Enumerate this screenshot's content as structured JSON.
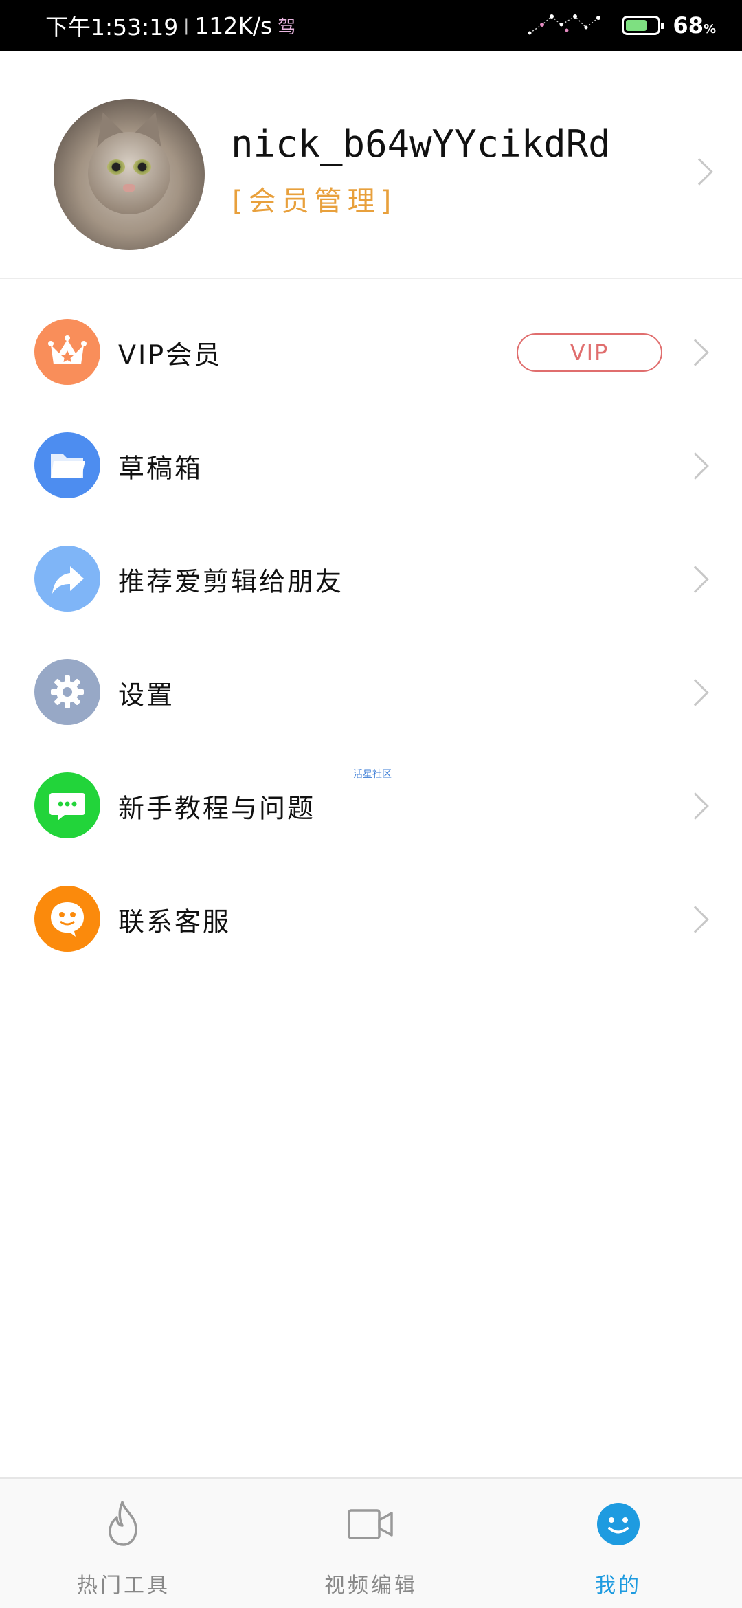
{
  "status_bar": {
    "time": "下午1:53:19",
    "speed": "112K/s",
    "carrier_glyph": "驾",
    "battery_percent": "68",
    "battery_unit": "%",
    "battery_level": 0.68
  },
  "profile": {
    "username": "nick_b64wYYcikdRd",
    "member_link": "[会员管理]"
  },
  "menu": {
    "items": [
      {
        "label": "VIP会员",
        "icon": "crown-icon",
        "color": "#f98e5a"
      },
      {
        "label": "草稿箱",
        "icon": "folder-icon",
        "color": "#4d8df0"
      },
      {
        "label": "推荐爱剪辑给朋友",
        "icon": "share-arrow-icon",
        "color": "#7fb5f7"
      },
      {
        "label": "设置",
        "icon": "gear-icon",
        "color": "#97a8c6"
      },
      {
        "label": "新手教程与问题",
        "icon": "chat-icon",
        "color": "#22d43a"
      },
      {
        "label": "联系客服",
        "icon": "support-face-icon",
        "color": "#fb8a0c"
      }
    ],
    "vip_badge": "VIP",
    "community_tag": "活星社区"
  },
  "tabbar": {
    "tabs": [
      {
        "label": "热门工具",
        "icon": "flame-icon"
      },
      {
        "label": "视频编辑",
        "icon": "video-camera-icon"
      },
      {
        "label": "我的",
        "icon": "smiley-icon",
        "active": true
      }
    ]
  }
}
